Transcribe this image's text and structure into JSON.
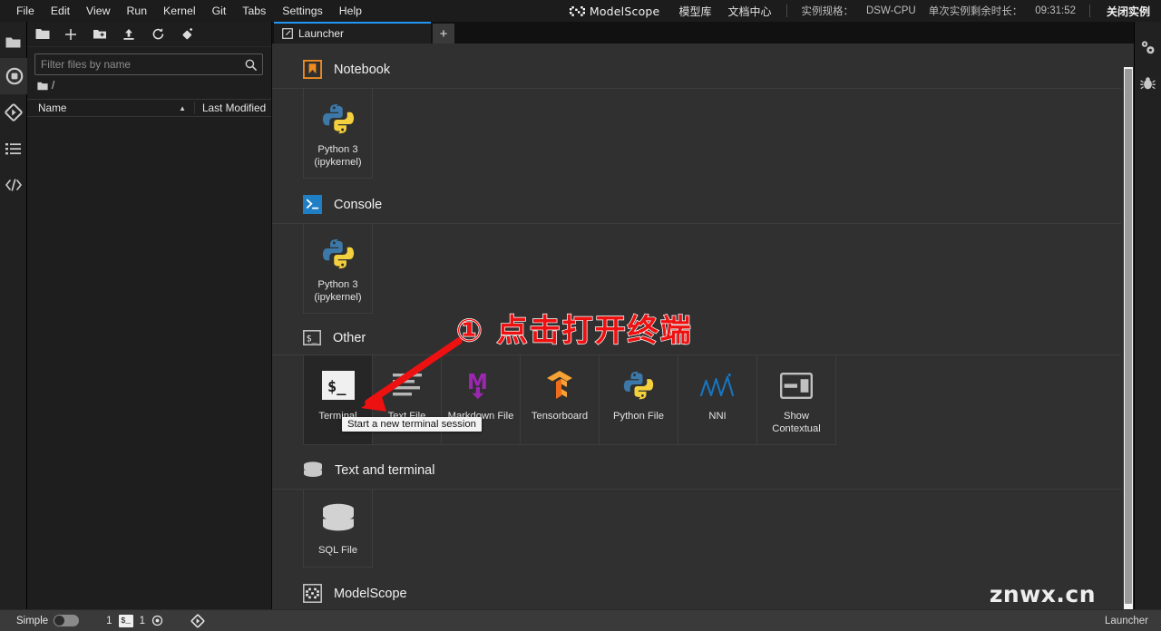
{
  "modelscope_bar": {
    "brand": "ModelScope",
    "nav": [
      {
        "label": "模型库"
      },
      {
        "label": "文档中心"
      }
    ],
    "instance_spec_label": "实例规格：",
    "instance_spec_value": "DSW-CPU",
    "remaining_label": "单次实例剩余时长：",
    "remaining_value": "09:31:52",
    "close_instance": "关闭实例"
  },
  "menubar": {
    "items": [
      {
        "label": "File"
      },
      {
        "label": "Edit"
      },
      {
        "label": "View"
      },
      {
        "label": "Run"
      },
      {
        "label": "Kernel"
      },
      {
        "label": "Git"
      },
      {
        "label": "Tabs"
      },
      {
        "label": "Settings"
      },
      {
        "label": "Help"
      }
    ]
  },
  "left_rail": {
    "items": [
      {
        "name": "file-browser",
        "icon": "folder-icon",
        "active": true
      },
      {
        "name": "running-sessions",
        "icon": "circle-stop-icon",
        "active": false
      },
      {
        "name": "git",
        "icon": "git-diamond-icon",
        "active": false
      },
      {
        "name": "table-of-contents",
        "icon": "list-icon",
        "active": false
      },
      {
        "name": "extension-manager",
        "icon": "code-brackets-icon",
        "active": false
      }
    ]
  },
  "right_rail": {
    "items": [
      {
        "name": "property-inspector",
        "icon": "gears-icon"
      },
      {
        "name": "debugger",
        "icon": "bug-icon"
      }
    ]
  },
  "file_browser": {
    "toolbar": [
      {
        "name": "folder-icon",
        "label": ""
      },
      {
        "name": "new-launcher-icon",
        "label": "+"
      },
      {
        "name": "new-folder-icon",
        "label": ""
      },
      {
        "name": "upload-icon",
        "label": ""
      },
      {
        "name": "refresh-icon",
        "label": ""
      },
      {
        "name": "new-checkpoint-icon",
        "label": ""
      }
    ],
    "filter_placeholder": "Filter files by name",
    "filter_value": "",
    "breadcrumb": "/",
    "columns": {
      "name": "Name",
      "last_modified": "Last Modified"
    },
    "rows": []
  },
  "dock": {
    "tabs": [
      {
        "label": "Launcher",
        "icon": "launcher-icon",
        "active": true
      }
    ],
    "add_tab_label": "+"
  },
  "launcher": {
    "sections": [
      {
        "id": "notebook",
        "title": "Notebook",
        "icon": "notebook-icon",
        "cards": [
          {
            "label": "Python 3\n(ipykernel)",
            "label_line1": "Python 3",
            "label_line2": "(ipykernel)",
            "icon": "python-icon"
          }
        ]
      },
      {
        "id": "console",
        "title": "Console",
        "icon": "console-icon",
        "cards": [
          {
            "label_line1": "Python 3",
            "label_line2": "(ipykernel)",
            "icon": "python-icon"
          }
        ]
      },
      {
        "id": "other",
        "title": "Other",
        "icon": "terminal-icon",
        "cards": [
          {
            "label_line1": "Terminal",
            "label_line2": "",
            "icon": "terminal-icon",
            "hover": true
          },
          {
            "label_line1": "Text File",
            "label_line2": "",
            "icon": "text-file-icon"
          },
          {
            "label_line1": "Markdown File",
            "label_line2": "",
            "icon": "markdown-icon"
          },
          {
            "label_line1": "Tensorboard",
            "label_line2": "",
            "icon": "tensorboard-icon"
          },
          {
            "label_line1": "Python File",
            "label_line2": "",
            "icon": "python-icon"
          },
          {
            "label_line1": "NNI",
            "label_line2": "",
            "icon": "nni-icon"
          },
          {
            "label_line1": "Show",
            "label_line2": "Contextual",
            "icon": "contextual-help-icon"
          }
        ]
      },
      {
        "id": "text-and-terminal",
        "title": "Text and terminal",
        "icon": "database-icon",
        "cards": [
          {
            "label_line1": "SQL File",
            "label_line2": "",
            "icon": "database-icon"
          }
        ]
      },
      {
        "id": "modelscope",
        "title": "ModelScope",
        "icon": "modelscope-icon",
        "cards": []
      }
    ]
  },
  "tooltip": {
    "text": "Start a new terminal session"
  },
  "annotation": {
    "text": "① 点击打开终端",
    "color": "#ee1111",
    "outline_color": "#ffffff"
  },
  "watermark": {
    "text": "znwx.cn"
  },
  "status_bar": {
    "mode_label": "Simple",
    "mode_on": false,
    "kernel_count": "1",
    "terminal_badge": "$_",
    "terminal_count": "1",
    "target_icon": "target-icon",
    "git_icon": "git-diamond-icon",
    "right_label": "Launcher"
  },
  "colors": {
    "accent_blue": "#2196f3",
    "panel_bg": "#303030",
    "sidebar_bg": "#1e1e1e",
    "rail_bg": "#212121",
    "annotation_red": "#ee1111",
    "python_blue": "#3c78a8",
    "python_yellow": "#f2d03e",
    "markdown_purple": "#9b27b0",
    "tensorboard_orange": "#f39019",
    "notebook_orange": "#ee8c20",
    "console_blue": "#1f7ec4",
    "nni_blue": "#1675c0"
  }
}
